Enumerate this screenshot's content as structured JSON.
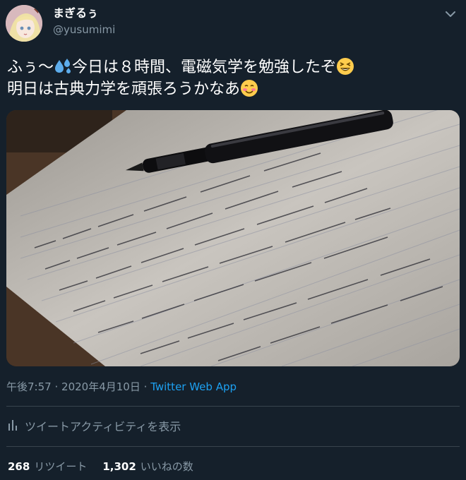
{
  "user": {
    "display_name": "まぎるぅ",
    "handle": "@yusumimi"
  },
  "tweet": {
    "line1_a": "ふぅ〜",
    "line1_b": "今日は８時間、電磁気学を勉強したぞ",
    "line2": "明日は古典力学を頑張ろうかなあ",
    "emojis": [
      "sweat-droplets-icon",
      "grinning-squinting-face-icon",
      "smiling-blush-face-icon"
    ]
  },
  "meta": {
    "time": "午後7:57",
    "separator": "·",
    "date": "2020年4月10日",
    "app": "Twitter Web App"
  },
  "activity": {
    "label": "ツイートアクティビティを表示"
  },
  "stats": {
    "retweets_count": "268",
    "retweets_label": "リツイート",
    "likes_count": "1,302",
    "likes_label": "いいねの数"
  },
  "colors": {
    "background": "#15202b",
    "text": "#ffffff",
    "muted": "#8899a6",
    "accent": "#1da1f2",
    "divider": "#38444d"
  }
}
